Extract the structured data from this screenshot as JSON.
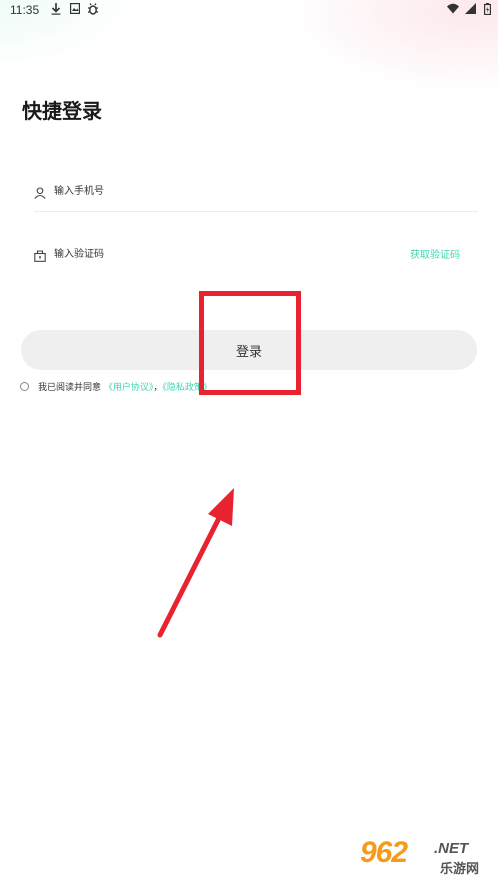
{
  "status_bar": {
    "time": "11:35",
    "left_icons": [
      "download-icon",
      "photo-icon",
      "bug-icon"
    ],
    "right_icons": [
      "wifi-icon",
      "signal-icon",
      "battery-icon"
    ]
  },
  "page": {
    "title": "快捷登录"
  },
  "phone_field": {
    "placeholder": "输入手机号",
    "value": ""
  },
  "code_field": {
    "placeholder": "输入验证码",
    "value": "",
    "get_code_label": "获取验证码"
  },
  "login_button": {
    "label": "登录"
  },
  "agreement": {
    "prefix": "我已阅读并同意",
    "user_agreement": "《用户协议》",
    "separator": "，",
    "privacy_policy": "《隐私政策》"
  },
  "annotation": {
    "color": "#e8222f"
  },
  "watermark": {
    "main": "962",
    "suffix": ".NET",
    "sub": "乐游网"
  },
  "colors": {
    "accent": "#3fd6b0",
    "button_bg": "#efefef"
  }
}
